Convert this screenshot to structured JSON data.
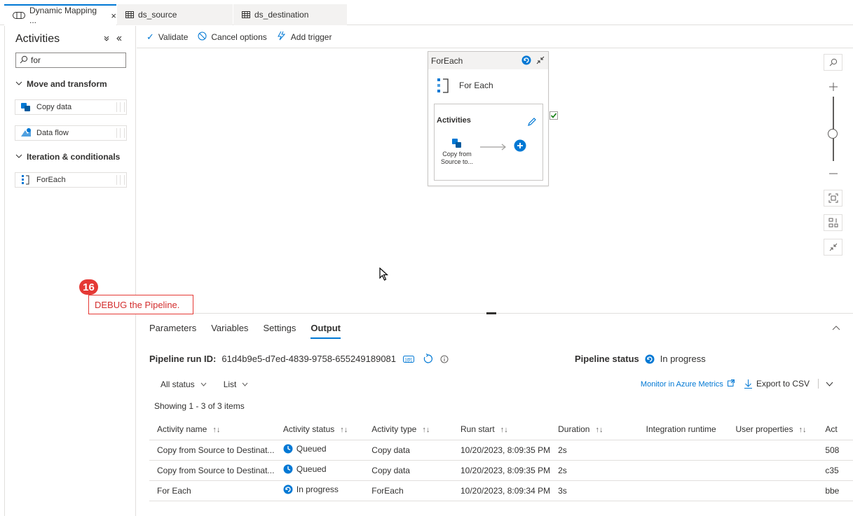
{
  "tabs": [
    {
      "label": "Dynamic Mapping ...",
      "icon": "pipeline-icon",
      "active": true
    },
    {
      "label": "ds_source",
      "icon": "table-icon",
      "active": false
    },
    {
      "label": "ds_destination",
      "icon": "table-icon",
      "active": false
    }
  ],
  "activities_panel": {
    "title": "Activities",
    "search_value": "for",
    "sections": [
      {
        "label": "Move and transform",
        "items": [
          "Copy data",
          "Data flow"
        ]
      },
      {
        "label": "Iteration & conditionals",
        "items": [
          "ForEach"
        ]
      }
    ]
  },
  "toolbar": {
    "validate": "Validate",
    "cancel_options": "Cancel options",
    "add_trigger": "Add trigger"
  },
  "canvas": {
    "foreach_header": "ForEach",
    "foreach_name": "For Each",
    "inner_title": "Activities",
    "copy_activity_line1": "Copy from",
    "copy_activity_line2": "Source to..."
  },
  "callout": {
    "number": "16",
    "text": "DEBUG the Pipeline."
  },
  "output_panel": {
    "tabs": [
      "Parameters",
      "Variables",
      "Settings",
      "Output"
    ],
    "active_tab": "Output",
    "run_id_label": "Pipeline run ID:",
    "run_id": "61d4b9e5-d7ed-4839-9758-655249189081",
    "status_label": "Pipeline status",
    "status_value": "In progress",
    "filter_status": "All status",
    "filter_view": "List",
    "monitor_link": "Monitor in Azure Metrics",
    "export_csv": "Export to CSV",
    "showing": "Showing 1 - 3 of 3 items",
    "columns": [
      "Activity name",
      "Activity status",
      "Activity type",
      "Run start",
      "Duration",
      "Integration runtime",
      "User properties",
      "Act"
    ],
    "rows": [
      {
        "name": "Copy from Source to Destinat...",
        "status": "Queued",
        "type": "Copy data",
        "run_start": "10/20/2023, 8:09:35 PM",
        "duration": "2s",
        "runtime": "",
        "user_props": "",
        "act": "508"
      },
      {
        "name": "Copy from Source to Destinat...",
        "status": "Queued",
        "type": "Copy data",
        "run_start": "10/20/2023, 8:09:35 PM",
        "duration": "2s",
        "runtime": "",
        "user_props": "",
        "act": "c35"
      },
      {
        "name": "For Each",
        "status": "In progress",
        "type": "ForEach",
        "run_start": "10/20/2023, 8:09:34 PM",
        "duration": "3s",
        "runtime": "",
        "user_props": "",
        "act": "bbe"
      }
    ]
  },
  "colors": {
    "accent": "#0078d4",
    "callout": "#e53935"
  }
}
